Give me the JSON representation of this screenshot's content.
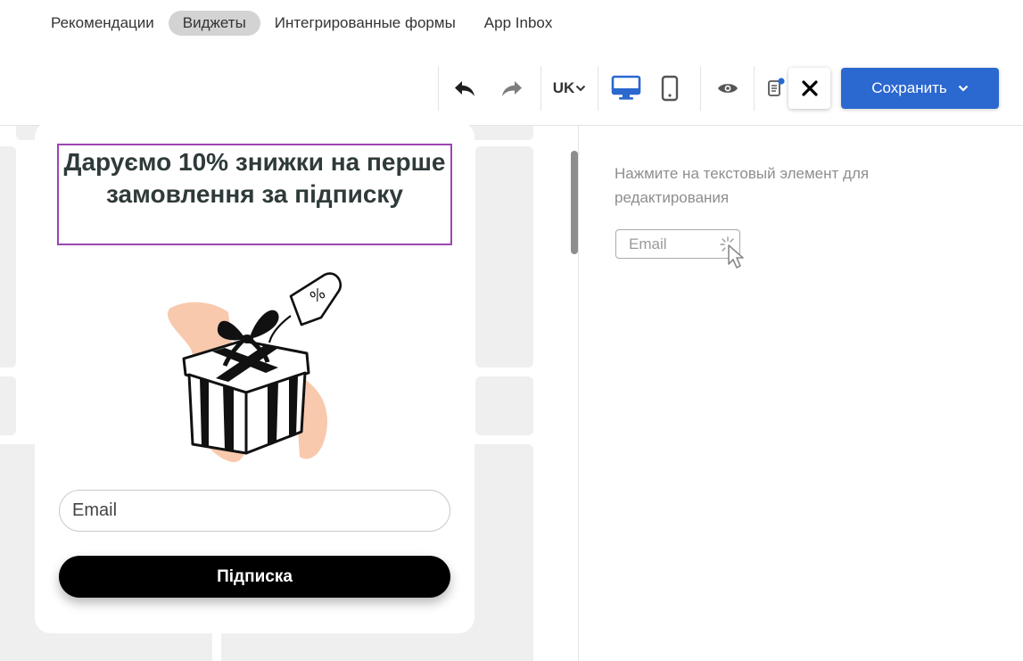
{
  "tabs": [
    {
      "label": "Рекомендации",
      "active": false
    },
    {
      "label": "Виджеты",
      "active": true
    },
    {
      "label": "Интегрированные формы",
      "active": false
    },
    {
      "label": "App Inbox",
      "active": false
    }
  ],
  "toolbar": {
    "undo_icon": "undo-icon",
    "redo_icon": "redo-icon",
    "language": "UK",
    "desktop_icon": "desktop-icon",
    "mobile_icon": "mobile-icon",
    "preview_icon": "eye-icon",
    "changes_icon": "clipboard-notification-icon",
    "close_icon": "close-icon",
    "save_label": "Сохранить"
  },
  "widget": {
    "headline": "Даруємо 10% знижки на перше замовлення за підписку",
    "illustration": "gift-box-illustration",
    "email_placeholder": "Email",
    "subscribe_label": "Підписка"
  },
  "hint_panel": {
    "text": "Нажмите на текстовый элемент для редактирования",
    "example_field": "Email",
    "cursor_icon": "click-cursor-icon"
  },
  "colors": {
    "accent": "#2b68cf",
    "selection_border": "#9b46b0",
    "active_tab": "#d3d3d3",
    "subscribe_button": "#000000"
  }
}
